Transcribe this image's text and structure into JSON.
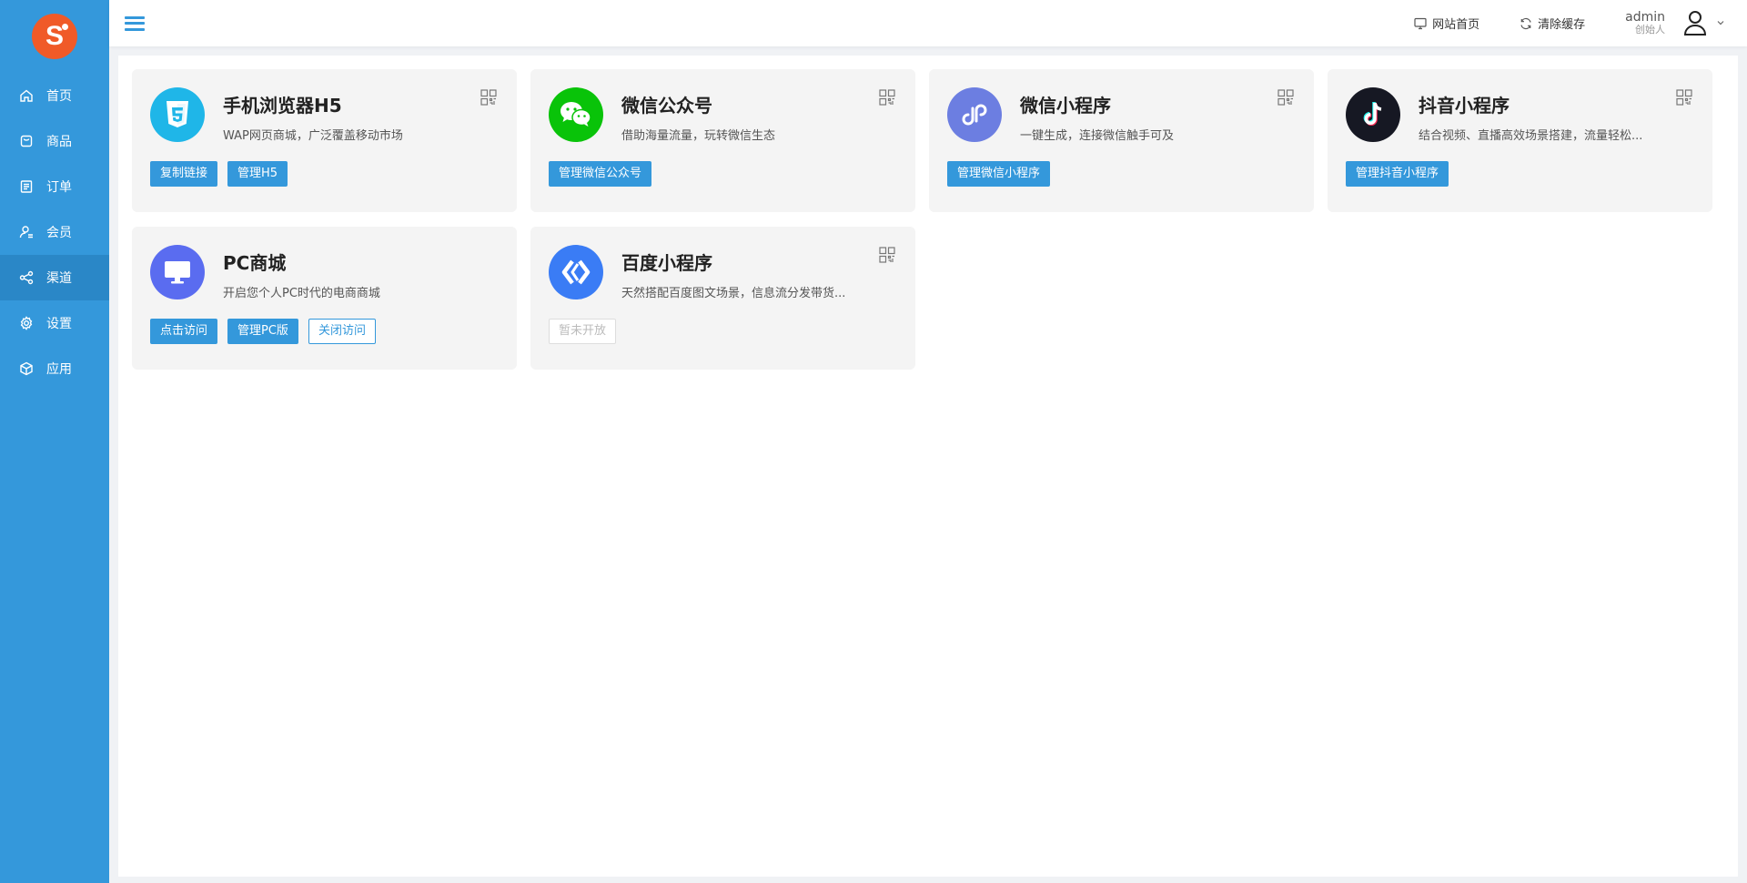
{
  "colors": {
    "sidebar": "#3498db",
    "sidebar_active": "#2a87c7",
    "logo": "#f05a28",
    "primary": "#3498db"
  },
  "logo": {
    "letter": "S"
  },
  "sidebar": {
    "items": [
      {
        "label": "首页",
        "icon": "home-icon"
      },
      {
        "label": "商品",
        "icon": "bag-icon"
      },
      {
        "label": "订单",
        "icon": "order-icon"
      },
      {
        "label": "会员",
        "icon": "user-icon"
      },
      {
        "label": "渠道",
        "icon": "share-icon",
        "active": true
      },
      {
        "label": "设置",
        "icon": "gear-icon"
      },
      {
        "label": "应用",
        "icon": "cube-icon"
      }
    ]
  },
  "header": {
    "site_home": "网站首页",
    "clear_cache": "清除缓存",
    "user_name": "admin",
    "user_role": "创始人"
  },
  "cards": [
    {
      "title": "手机浏览器H5",
      "desc": "WAP网页商城，广泛覆盖移动市场",
      "icon": "html5-icon",
      "buttons": [
        "复制链接",
        "管理H5"
      ]
    },
    {
      "title": "微信公众号",
      "desc": "借助海量流量，玩转微信生态",
      "icon": "wechat-icon",
      "buttons": [
        "管理微信公众号"
      ]
    },
    {
      "title": "微信小程序",
      "desc": "一键生成，连接微信触手可及",
      "icon": "miniprogram-icon",
      "buttons": [
        "管理微信小程序"
      ]
    },
    {
      "title": "抖音小程序",
      "desc": "结合视频、直播高效场景搭建，流量轻松...",
      "icon": "douyin-icon",
      "buttons": [
        "管理抖音小程序"
      ]
    },
    {
      "title": "PC商城",
      "desc": "开启您个人PC时代的电商商城",
      "icon": "monitor-icon",
      "buttons": [
        "点击访问",
        "管理PC版",
        "关闭访问"
      ]
    },
    {
      "title": "百度小程序",
      "desc": "天然搭配百度图文场景，信息流分发带货...",
      "icon": "baidu-icon",
      "buttons": [
        "暂未开放"
      ]
    }
  ]
}
